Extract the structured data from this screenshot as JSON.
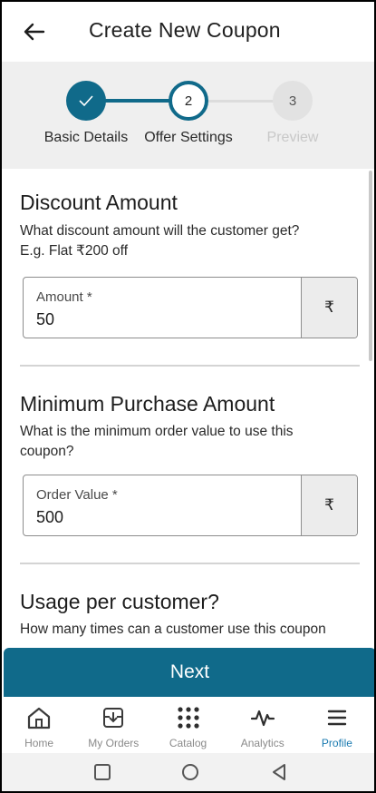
{
  "header": {
    "title": "Create New Coupon",
    "back_icon": "arrow-left-icon"
  },
  "stepper": {
    "steps": [
      {
        "label": "Basic Details",
        "number": "",
        "state": "completed",
        "icon": "check-icon"
      },
      {
        "label": "Offer Settings",
        "number": "2",
        "state": "active"
      },
      {
        "label": "Preview",
        "number": "3",
        "state": "inactive"
      }
    ],
    "colors": {
      "active": "#106a8a",
      "inactive": "#dddddd",
      "inactive_text": "#c8c8c8"
    }
  },
  "sections": {
    "discount": {
      "title": "Discount Amount",
      "description": "What discount amount will the customer get?\nE.g. Flat ₹200 off",
      "field_label": "Amount *",
      "field_value": "50",
      "suffix": "₹"
    },
    "min_purchase": {
      "title": "Minimum Purchase Amount",
      "description": "What is the minimum order value to use this coupon?",
      "field_label": "Order Value *",
      "field_value": "500",
      "suffix": "₹"
    },
    "usage": {
      "title": "Usage per customer?",
      "description": "How many times can a customer use this coupon"
    }
  },
  "actions": {
    "next_label": "Next"
  },
  "bottom_nav": {
    "items": [
      {
        "label": "Home",
        "icon": "home-icon",
        "active": false
      },
      {
        "label": "My Orders",
        "icon": "orders-box-icon",
        "active": false
      },
      {
        "label": "Catalog",
        "icon": "grid-dots-icon",
        "active": false
      },
      {
        "label": "Analytics",
        "icon": "pulse-icon",
        "active": false
      },
      {
        "label": "Profile",
        "icon": "menu-icon",
        "active": true
      }
    ],
    "colors": {
      "active": "#1a7ab0",
      "inactive": "#8a8a8a"
    }
  },
  "system_nav": {
    "buttons": [
      "square-recents-icon",
      "circle-home-icon",
      "triangle-back-icon"
    ]
  }
}
